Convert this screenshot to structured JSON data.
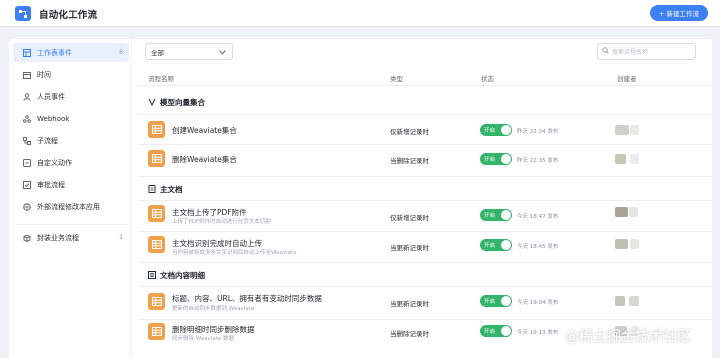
{
  "header": {
    "title": "自动化工作流",
    "new_button": "+ 新建工作流",
    "app_icon": "workflow-app-icon"
  },
  "sidebar": {
    "items": [
      {
        "label": "工作表事件",
        "count": "6",
        "icon": "table-icon",
        "active": true
      },
      {
        "label": "时间",
        "icon": "calendar-icon"
      },
      {
        "label": "人员事件",
        "icon": "person-icon"
      },
      {
        "label": "Webhook",
        "icon": "webhook-icon"
      },
      {
        "label": "子流程",
        "icon": "subflow-icon"
      },
      {
        "label": "自定义动作",
        "icon": "custom-action-icon"
      },
      {
        "label": "审批流程",
        "icon": "approval-icon"
      },
      {
        "label": "外部流程修改本应用",
        "icon": "external-flow-icon"
      },
      {
        "label": "封装业务流程",
        "count": "1",
        "icon": "package-icon"
      }
    ]
  },
  "filter": {
    "selected": "全部",
    "search_placeholder": "搜索流程名称"
  },
  "columns": {
    "name": "流程名称",
    "type": "类型",
    "status": "状态",
    "creator": "创建者"
  },
  "groups": [
    {
      "title": "模型向量集合",
      "icon": "vector-icon",
      "rows": [
        {
          "name": "创建Weaviate集合",
          "desc": "",
          "type": "仅新增记录时",
          "status": "开启",
          "time": "昨天 22:34 发布"
        },
        {
          "name": "删除Weaviate集合",
          "desc": "",
          "type": "当删除记录时",
          "status": "开启",
          "time": "昨天 22:35 发布"
        }
      ]
    },
    {
      "title": "主文档",
      "icon": "document-icon",
      "rows": [
        {
          "name": "主文档上传了PDF附件",
          "desc": "上传了PDF附件时自动进行分页文本切割",
          "type": "仅新增记录时",
          "status": "开启",
          "time": "今天 18:47 发布"
        },
        {
          "name": "主文档识别完成时自动上传",
          "desc": "当内容被拆成多条文字识别后自动上传至Weaviate",
          "type": "当更新记录时",
          "status": "开启",
          "time": "今天 18:45 发布"
        }
      ]
    },
    {
      "title": "文档内容明细",
      "icon": "detail-list-icon",
      "rows": [
        {
          "name": "标题、内容、URL、拥有者有变动时同步数据",
          "desc": "更新的自动同步数据到 Weaviate",
          "type": "当更新记录时",
          "status": "开启",
          "time": "今天 19:04 发布"
        },
        {
          "name": "删除明细时同步删除数据",
          "desc": "同步删除 Weaviate 数据",
          "type": "当删除记录时",
          "status": "开启",
          "time": "今天 19:13 发布"
        }
      ]
    }
  ],
  "watermark": "@稀土掘金技术社区",
  "colors": {
    "accent": "#3d7ff5",
    "toggle_on": "#34b36b",
    "row_icon": "#f0a04b"
  }
}
